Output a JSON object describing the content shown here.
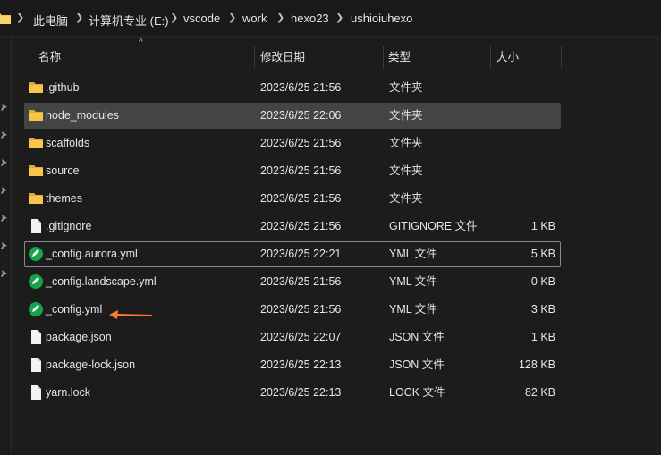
{
  "breadcrumb": {
    "segments": [
      "此电脑",
      "计算机专业 (E:)",
      "vscode",
      "work",
      "hexo23",
      "ushioiuhexo"
    ]
  },
  "columns": {
    "name": "名称",
    "date": "修改日期",
    "type": "类型",
    "size": "大小"
  },
  "colors": {
    "folder": "#f6c54a",
    "selected_row": "#444444",
    "annotation_arrow": "#ff7a2e",
    "yml_icon": "#16a34a"
  },
  "files": [
    {
      "name": ".github",
      "date": "2023/6/25 21:56",
      "type": "文件夹",
      "size": "",
      "icon": "folder-icon"
    },
    {
      "name": "node_modules",
      "date": "2023/6/25 22:06",
      "type": "文件夹",
      "size": "",
      "icon": "folder-icon"
    },
    {
      "name": "scaffolds",
      "date": "2023/6/25 21:56",
      "type": "文件夹",
      "size": "",
      "icon": "folder-icon"
    },
    {
      "name": "source",
      "date": "2023/6/25 21:56",
      "type": "文件夹",
      "size": "",
      "icon": "folder-icon"
    },
    {
      "name": "themes",
      "date": "2023/6/25 21:56",
      "type": "文件夹",
      "size": "",
      "icon": "folder-icon"
    },
    {
      "name": ".gitignore",
      "date": "2023/6/25 21:56",
      "type": "GITIGNORE 文件",
      "size": "1 KB",
      "icon": "file-icon"
    },
    {
      "name": "_config.aurora.yml",
      "date": "2023/6/25 22:21",
      "type": "YML 文件",
      "size": "5 KB",
      "icon": "yml-file-icon"
    },
    {
      "name": "_config.landscape.yml",
      "date": "2023/6/25 21:56",
      "type": "YML 文件",
      "size": "0 KB",
      "icon": "yml-file-icon"
    },
    {
      "name": "_config.yml",
      "date": "2023/6/25 21:56",
      "type": "YML 文件",
      "size": "3 KB",
      "icon": "yml-file-icon"
    },
    {
      "name": "package.json",
      "date": "2023/6/25 22:07",
      "type": "JSON 文件",
      "size": "1 KB",
      "icon": "file-icon"
    },
    {
      "name": "package-lock.json",
      "date": "2023/6/25 22:13",
      "type": "JSON 文件",
      "size": "128 KB",
      "icon": "file-icon"
    },
    {
      "name": "yarn.lock",
      "date": "2023/6/25 22:13",
      "type": "LOCK 文件",
      "size": "82 KB",
      "icon": "file-icon"
    }
  ]
}
